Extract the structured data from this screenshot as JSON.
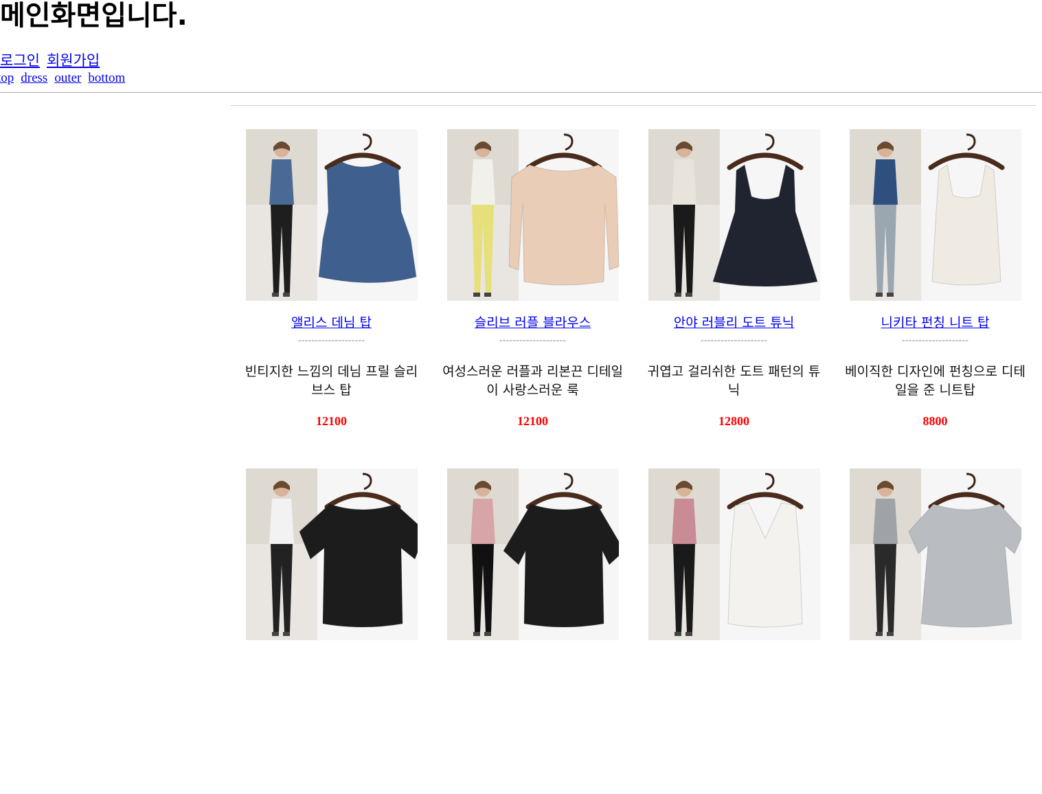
{
  "header": {
    "title": "메인화면입니다.",
    "auth_links": [
      "로그인",
      "회원가입"
    ],
    "category_links": [
      "top",
      "dress",
      "outer",
      "bottom"
    ]
  },
  "products": [
    {
      "name": "앨리스 데님 탑",
      "divider": "--------------------",
      "description": "빈티지한 느낌의 데님 프릴 슬리브스 탑",
      "price": "12100",
      "garment_color": "#3f5f8f",
      "garment_type": "ruffle-sleeveless",
      "model_colors": [
        "#4a6a95",
        "#1e1e1e"
      ]
    },
    {
      "name": "슬리브 러플 블라우스",
      "divider": "--------------------",
      "description": "여성스러운 러플과 리본끈 디테일이 사랑스러운 룩",
      "price": "12100",
      "garment_color": "#e9cdb6",
      "garment_type": "long-sleeve",
      "model_colors": [
        "#f2f0ea",
        "#e6e07a"
      ]
    },
    {
      "name": "안야 러블리 도트 튜닉",
      "divider": "--------------------",
      "description": "귀엽고 걸리쉬한 도트 패턴의 튜닉",
      "price": "12800",
      "garment_color": "#1f2430",
      "garment_type": "cami-tunic",
      "model_colors": [
        "#e8e3db",
        "#1a1a1a"
      ]
    },
    {
      "name": "니키타 펀칭 니트 탑",
      "divider": "--------------------",
      "description": "베이직한 디자인에 펀칭으로 디테일을 준 니트탑",
      "price": "8800",
      "garment_color": "#efebe3",
      "garment_type": "cami",
      "model_colors": [
        "#2f4f7f",
        "#9aa6b0"
      ]
    },
    {
      "name": "",
      "divider": "",
      "description": "",
      "price": "",
      "garment_color": "#1c1c1c",
      "garment_type": "flare-sleeve",
      "model_colors": [
        "#f2f2f2",
        "#222222"
      ]
    },
    {
      "name": "",
      "divider": "",
      "description": "",
      "price": "",
      "garment_color": "#1c1c1c",
      "garment_type": "bell-sleeve",
      "model_colors": [
        "#d7a4a8",
        "#111111"
      ]
    },
    {
      "name": "",
      "divider": "",
      "description": "",
      "price": "",
      "garment_color": "#f4f2ee",
      "garment_type": "v-sleeveless",
      "model_colors": [
        "#c98b94",
        "#1a1a1a"
      ]
    },
    {
      "name": "",
      "divider": "",
      "description": "",
      "price": "",
      "garment_color": "#b9bcc0",
      "garment_type": "gingham-flare",
      "model_colors": [
        "#9fa3a8",
        "#2a2a2a"
      ]
    }
  ]
}
